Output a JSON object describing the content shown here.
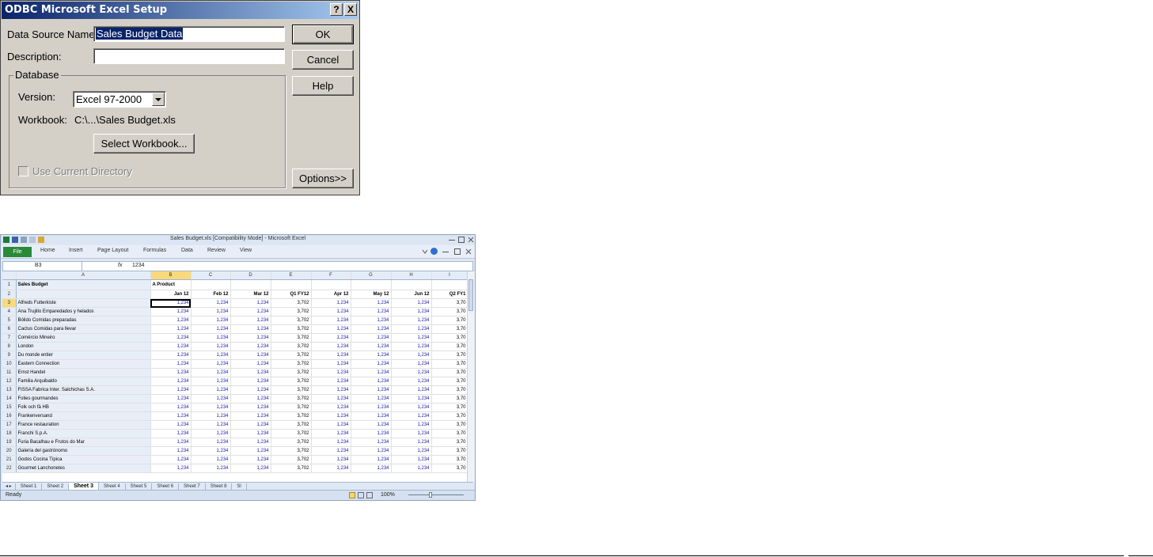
{
  "dialog": {
    "title": "ODBC Microsoft Excel Setup",
    "help_btn": "?",
    "close_btn": "X",
    "dsn_label": "Data Source Name:",
    "dsn_value": "Sales Budget Data",
    "desc_label": "Description:",
    "desc_value": "",
    "group_label": "Database",
    "version_label": "Version:",
    "version_value": "Excel 97-2000",
    "workbook_label": "Workbook:",
    "workbook_value": "C:\\...\\Sales Budget.xls",
    "select_workbook": "Select Workbook...",
    "use_current_dir": "Use Current Directory",
    "ok": "OK",
    "cancel": "Cancel",
    "help": "Help",
    "options": "Options>>"
  },
  "excel": {
    "title": "Sales Budget.xls [Compatibility Mode] - Microsoft Excel",
    "file_tab": "File",
    "tabs": [
      "Home",
      "Insert",
      "Page Layout",
      "Formulas",
      "Data",
      "Review",
      "View"
    ],
    "name_box": "B3",
    "fx": "fx",
    "formula": "1234",
    "columns": [
      "",
      "A",
      "B",
      "C",
      "D",
      "E",
      "F",
      "G",
      "H",
      "I"
    ],
    "title_a": "Sales Budget",
    "title_b": "A Product",
    "headers": [
      "Jan 12",
      "Feb 12",
      "Mar 12",
      "Q1 FY12",
      "Apr 12",
      "May 12",
      "Jun 12",
      "Q2 FY1"
    ],
    "rows": [
      {
        "n": "3",
        "name": "Alfreds Futterkiste"
      },
      {
        "n": "4",
        "name": "Ana Trujillo Emparedados y helados"
      },
      {
        "n": "5",
        "name": "Bólido Comidas preparadas"
      },
      {
        "n": "6",
        "name": "Cactus Comidas para llevar"
      },
      {
        "n": "7",
        "name": "Comércio Mineiro"
      },
      {
        "n": "8",
        "name": "London"
      },
      {
        "n": "9",
        "name": "Du monde entier"
      },
      {
        "n": "10",
        "name": "Eastern Connection"
      },
      {
        "n": "11",
        "name": "Ernst Handel"
      },
      {
        "n": "12",
        "name": "Familia Arquibaldo"
      },
      {
        "n": "13",
        "name": "FISSA Fabrica Inter. Salchichas S.A."
      },
      {
        "n": "14",
        "name": "Folies gourmandes"
      },
      {
        "n": "15",
        "name": "Folk och fä HB"
      },
      {
        "n": "16",
        "name": "Frankenversand"
      },
      {
        "n": "17",
        "name": "France restauration"
      },
      {
        "n": "18",
        "name": "Franchi S.p.A."
      },
      {
        "n": "19",
        "name": "Furia Bacalhau e Frutos do Mar"
      },
      {
        "n": "20",
        "name": "Galería del gastrónomo"
      },
      {
        "n": "21",
        "name": "Godos Cocina Típica"
      },
      {
        "n": "22",
        "name": "Gourmet Lanchonetes"
      }
    ],
    "month_value": "1,234",
    "quarter_value": "3,702",
    "q2_value": "3,70",
    "sheets": [
      "Sheet 1",
      "Sheet 2",
      "Sheet 3",
      "Sheet 4",
      "Sheet 5",
      "Sheet 6",
      "Sheet 7",
      "Sheet 8",
      "Sl"
    ],
    "active_sheet": "Sheet 3",
    "status": "Ready",
    "zoom": "100%"
  }
}
